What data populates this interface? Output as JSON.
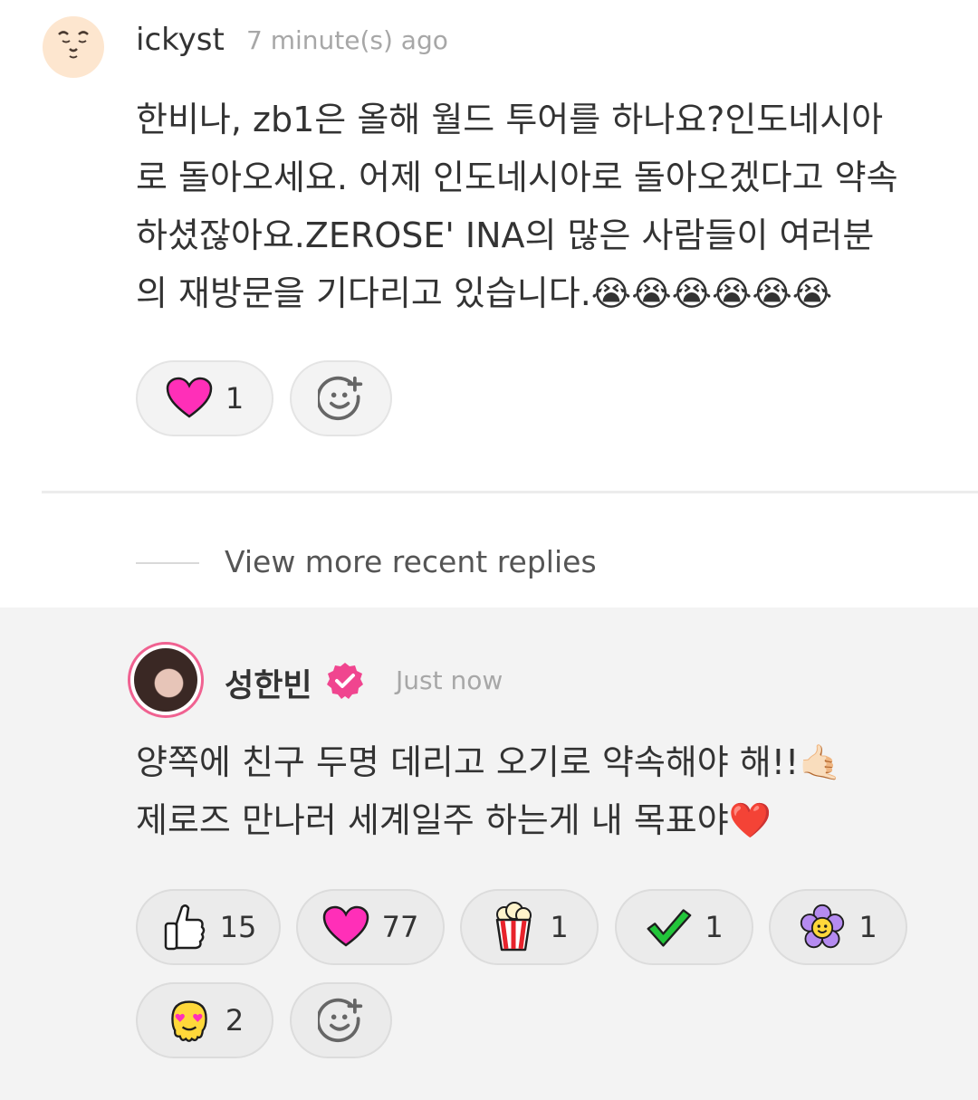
{
  "comment": {
    "username": "ickyst",
    "time": "7 minute(s) ago",
    "avatar_icon": "smiley-face-icon",
    "text": "한비나, zb1은 올해 월드 투어를 하나요?인도네시아\n로 돌아오세요. 어제 인도네시아로 돌아오겠다고 약속\n하셨잖아요.ZEROSE' INA의 많은 사람들이 여러분\n의 재방문을 기다리고 있습니다.😭😭😭😭😭😭",
    "reactions": [
      {
        "icon": "heart-icon",
        "count": "1"
      }
    ],
    "add_reaction_icon": "add-emoji-icon"
  },
  "view_more": {
    "label": "View more recent replies"
  },
  "reply": {
    "username": "성한빈",
    "verified_icon": "verified-badge-icon",
    "time": "Just now",
    "text": "양쪽에 친구 두명 데리고 오기로 약속해야 해!!🤙🏻\n제로즈 만나러 세계일주 하는게 내 목표야❤️",
    "reactions": [
      {
        "icon": "thumbs-up-icon",
        "count": "15"
      },
      {
        "icon": "heart-icon",
        "count": "77"
      },
      {
        "icon": "popcorn-icon",
        "count": "1"
      },
      {
        "icon": "checkmark-icon",
        "count": "1"
      },
      {
        "icon": "flower-icon",
        "count": "1"
      },
      {
        "icon": "melting-love-face-icon",
        "count": "2"
      }
    ],
    "add_reaction_icon": "add-emoji-icon"
  },
  "colors": {
    "accent_pink": "#f0458f",
    "heart": "#ff2fb8",
    "reply_background": "#f3f3f3"
  }
}
